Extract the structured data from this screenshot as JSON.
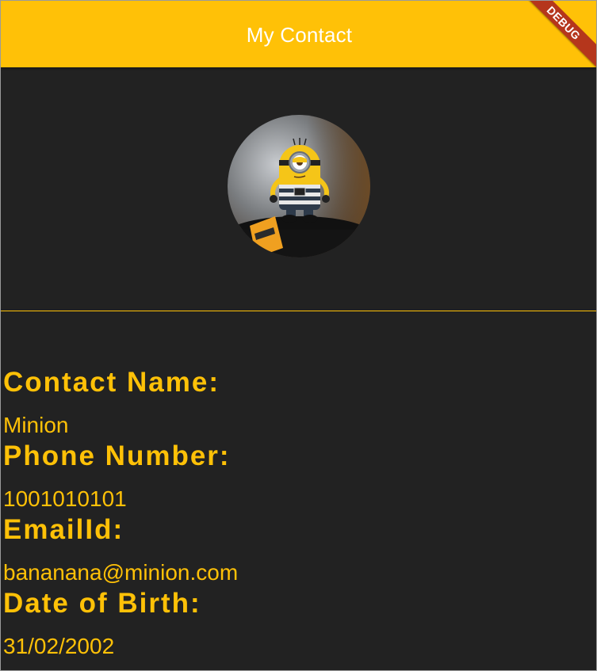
{
  "appbar": {
    "title": "My Contact",
    "background_color": "#FFC107",
    "debug_label": "DEBUG"
  },
  "avatar": {
    "icon": "minion-photo-avatar"
  },
  "accent_color": "#FFC107",
  "fields": [
    {
      "label": "Contact Name:",
      "value": "Minion"
    },
    {
      "label": "Phone Number:",
      "value": "1001010101"
    },
    {
      "label": "EmailId:",
      "value": "bananana@minion.com"
    },
    {
      "label": "Date of Birth:",
      "value": "31/02/2002"
    }
  ]
}
